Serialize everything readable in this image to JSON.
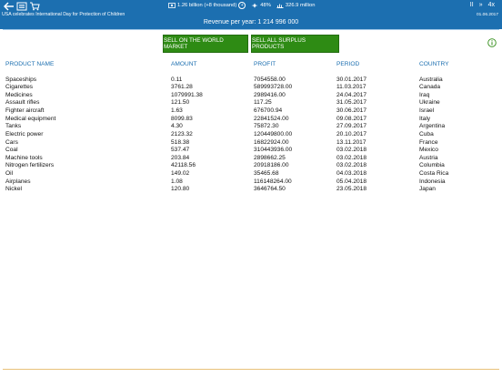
{
  "topbar": {
    "back_icon": "back-arrow-icon",
    "menu_icon": "menu-icon",
    "cart_icon": "cart-icon",
    "population": "1.26 billion (+8 thousand)",
    "approval": "48%",
    "budget": "326.9 million",
    "pause_label": "II",
    "fast_forward_label": "»",
    "speed_label": "4x",
    "news": "USA celebrates International Day for Protection of Children",
    "date": "01.06.2017",
    "revenue": "Revenue per year: 1 214 996 000",
    "bar_color": "#1c6fb0"
  },
  "actions": {
    "sell_world": "SELL ON THE WORLD MARKET",
    "sell_surplus": "SELL ALL SURPLUS PRODUCTS",
    "button_color": "#2e8b14"
  },
  "table": {
    "headers": [
      "PRODUCT NAME",
      "AMOUNT",
      "PROFIT",
      "PERIOD",
      "COUNTRY"
    ],
    "rows": [
      [
        "Spaceships",
        "0.11",
        "7054558.00",
        "30.01.2017",
        "Australia"
      ],
      [
        "Cigarettes",
        "3761.28",
        "589993728.00",
        "11.03.2017",
        "Canada"
      ],
      [
        "Medicines",
        "1079991.38",
        "2989416.00",
        "24.04.2017",
        "Iraq"
      ],
      [
        "Assault rifles",
        "121.50",
        "117.25",
        "31.05.2017",
        "Ukraine"
      ],
      [
        "Fighter aircraft",
        "1.63",
        "676700.94",
        "30.06.2017",
        "Israel"
      ],
      [
        "Medical equipment",
        "8099.83",
        "22841524.00",
        "09.08.2017",
        "Italy"
      ],
      [
        "Tanks",
        "4.30",
        "75872.30",
        "27.09.2017",
        "Argentina"
      ],
      [
        "Electric power",
        "2123.32",
        "120449800.00",
        "20.10.2017",
        "Cuba"
      ],
      [
        "Cars",
        "518.38",
        "16822924.00",
        "13.11.2017",
        "France"
      ],
      [
        "Coal",
        "537.47",
        "310443936.00",
        "03.02.2018",
        "Mexico"
      ],
      [
        "Machine tools",
        "203.84",
        "2898662.25",
        "03.02.2018",
        "Austria"
      ],
      [
        "Nitrogen fertilizers",
        "42118.56",
        "20918186.00",
        "03.02.2018",
        "Columbia"
      ],
      [
        "Oil",
        "149.02",
        "35465.68",
        "04.03.2018",
        "Costa Rica"
      ],
      [
        "Airplanes",
        "1.08",
        "116148264.00",
        "05.04.2018",
        "Indonesia"
      ],
      [
        "Nickel",
        "120.80",
        "3646764.50",
        "23.05.2018",
        "Japan"
      ]
    ]
  }
}
